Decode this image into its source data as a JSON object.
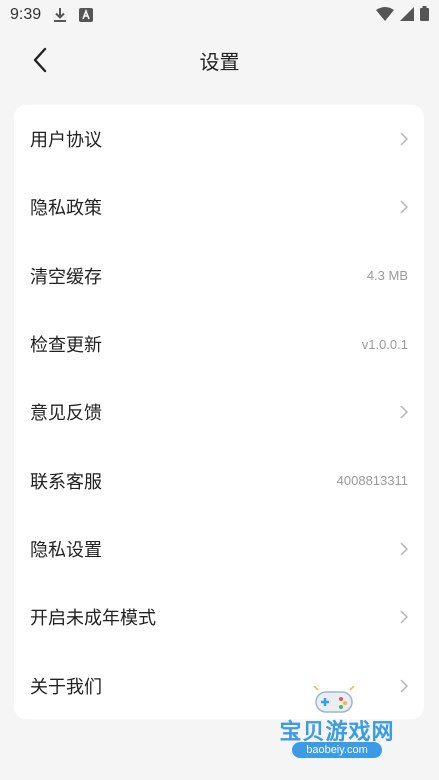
{
  "status_bar": {
    "time": "9:39",
    "icons": [
      "download-icon",
      "a-box-icon",
      "wifi-icon",
      "signal-icon",
      "battery-icon"
    ]
  },
  "nav": {
    "title": "设置",
    "back_icon": "chevron-left-icon"
  },
  "settings": {
    "items": [
      {
        "label": "用户协议",
        "value": null
      },
      {
        "label": "隐私政策",
        "value": null
      },
      {
        "label": "清空缓存",
        "value": "4.3 MB"
      },
      {
        "label": "检查更新",
        "value": "v1.0.0.1"
      },
      {
        "label": "意见反馈",
        "value": null
      },
      {
        "label": "联系客服",
        "value": "4008813311"
      },
      {
        "label": "隐私设置",
        "value": null
      },
      {
        "label": "开启未成年模式",
        "value": null
      },
      {
        "label": "关于我们",
        "value": null
      }
    ]
  },
  "watermark": {
    "text": "宝贝游戏网",
    "url": "baobeiy.com"
  },
  "colors": {
    "background": "#f5f5f5",
    "card": "#ffffff",
    "muted_text": "#9a9a9a",
    "watermark_blue": "#3a9be6"
  }
}
